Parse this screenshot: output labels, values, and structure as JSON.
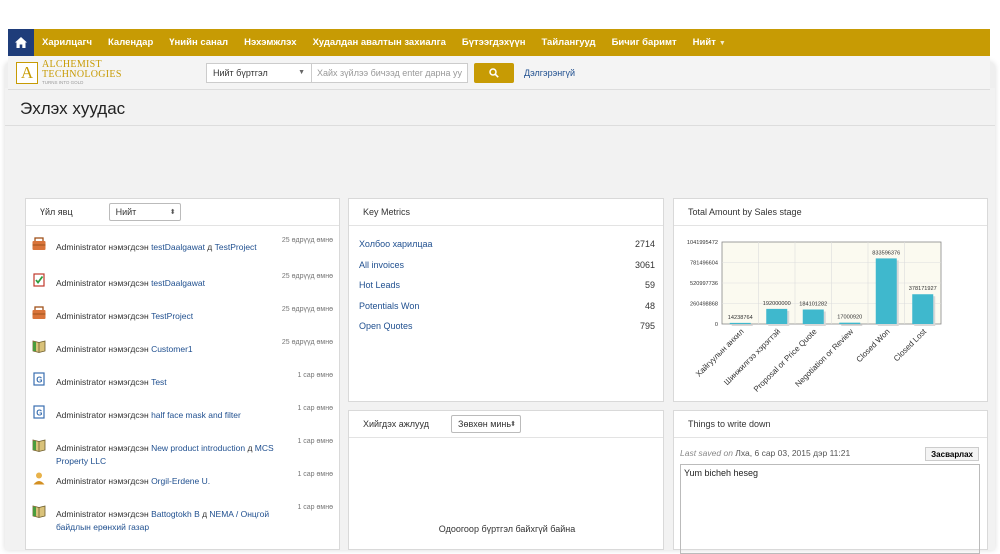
{
  "nav": {
    "items": [
      "Харилцагч",
      "Календар",
      "Үнийн санал",
      "Нэхэмжлэх",
      "Худалдан авалтын захиалга",
      "Бүтээгдэхүүн",
      "Тайлангууд",
      "Бичиг баримт",
      "Нийт"
    ]
  },
  "logo": {
    "name_line1": "ALCHEMIST",
    "name_line2": "TECHNOLOGIES",
    "tagline": "TURNS INTO GOLD"
  },
  "search": {
    "scope": "Нийт бүртгэл",
    "placeholder": "Хайх зүйлээ бичээд enter дарна уу",
    "advanced": "Дэлгэрэнгүй"
  },
  "page_title": "Эхлэх хуудас",
  "activity": {
    "title": "Үйл явц",
    "filter": "Нийт",
    "items": [
      {
        "icon": "briefcase-icon",
        "prefix": "Administrator нэмэгдсэн ",
        "link": "testDaalgawat",
        "mid": " д ",
        "link2": "TestProject",
        "time": "25 өдрүүд өмнө"
      },
      {
        "icon": "checklist-icon",
        "prefix": "Administrator нэмэгдсэн ",
        "link": "testDaalgawat",
        "mid": "",
        "link2": "",
        "time": "25 өдрүүд өмнө"
      },
      {
        "icon": "briefcase-icon",
        "prefix": "Administrator нэмэгдсэн ",
        "link": "TestProject",
        "mid": "",
        "link2": "",
        "time": "25 өдрүүд өмнө"
      },
      {
        "icon": "book-icon",
        "prefix": "Administrator нэмэгдсэн ",
        "link": "Customer1",
        "mid": "",
        "link2": "",
        "time": "25 өдрүүд өмнө"
      },
      {
        "icon": "product-icon",
        "prefix": "Administrator нэмэгдсэн ",
        "link": "Test",
        "mid": "",
        "link2": "",
        "time": "1 сар өмнө"
      },
      {
        "icon": "product-icon",
        "prefix": "Administrator нэмэгдсэн ",
        "link": "half face mask and filter",
        "mid": "",
        "link2": "",
        "time": "1 сар өмнө"
      },
      {
        "icon": "book-icon",
        "prefix": "Administrator нэмэгдсэн ",
        "link": "New product introduction",
        "mid": " д ",
        "link2": "MCS Property LLC",
        "time": "1 сар өмнө"
      },
      {
        "icon": "contact-icon",
        "prefix": "Administrator нэмэгдсэн ",
        "link": "Orgil-Erdene U.",
        "mid": "",
        "link2": "",
        "time": "1 сар өмнө"
      },
      {
        "icon": "book-icon",
        "prefix": "Administrator нэмэгдсэн ",
        "link": "Battogtokh B",
        "mid": " д ",
        "link2": "NEMA / Онцгой байдлын ерөнхий газар",
        "time": "1 сар өмнө"
      }
    ]
  },
  "metrics": {
    "title": "Key Metrics",
    "items": [
      {
        "label": "Холбоо харилцаа",
        "value": "2714"
      },
      {
        "label": "All invoices",
        "value": "3061"
      },
      {
        "label": "Hot Leads",
        "value": "59"
      },
      {
        "label": "Potentials Won",
        "value": "48"
      },
      {
        "label": "Open Quotes",
        "value": "795"
      }
    ]
  },
  "chart_panel": {
    "title": "Total Amount by Sales stage"
  },
  "chart_data": {
    "type": "bar",
    "title": "Total Amount by Sales stage",
    "categories": [
      "Хайгуулын анхил",
      "Шинжилгээ хэрэгтэй",
      "Proposal or Price Quote",
      "Negotiation or Review",
      "Closed Won",
      "Closed Lost"
    ],
    "values": [
      14238764,
      192000000,
      184101282,
      17000920,
      833596376,
      378171927
    ],
    "value_labels": [
      "14238764",
      "192000000",
      "184101282",
      "17000920",
      "833596376",
      "378171927"
    ],
    "y_ticks": [
      "1041995472",
      "781496604",
      "520997736",
      "260498868",
      "0"
    ],
    "ylim": [
      0,
      1041995472
    ],
    "color": "#3fb8cd",
    "grid": true
  },
  "tasks": {
    "title": "Хийгдэх ажлууд",
    "filter": "Зөвхөн минь",
    "empty": "Одоогоор бүртгэл байхгүй байна"
  },
  "notes": {
    "title": "Things to write down",
    "saved_label": "Last saved on",
    "saved_date": " Лха, 6 сар 03, 2015 дэр 11:21",
    "edit_button": "Засварлах",
    "content": "Yum bicheh heseg"
  }
}
